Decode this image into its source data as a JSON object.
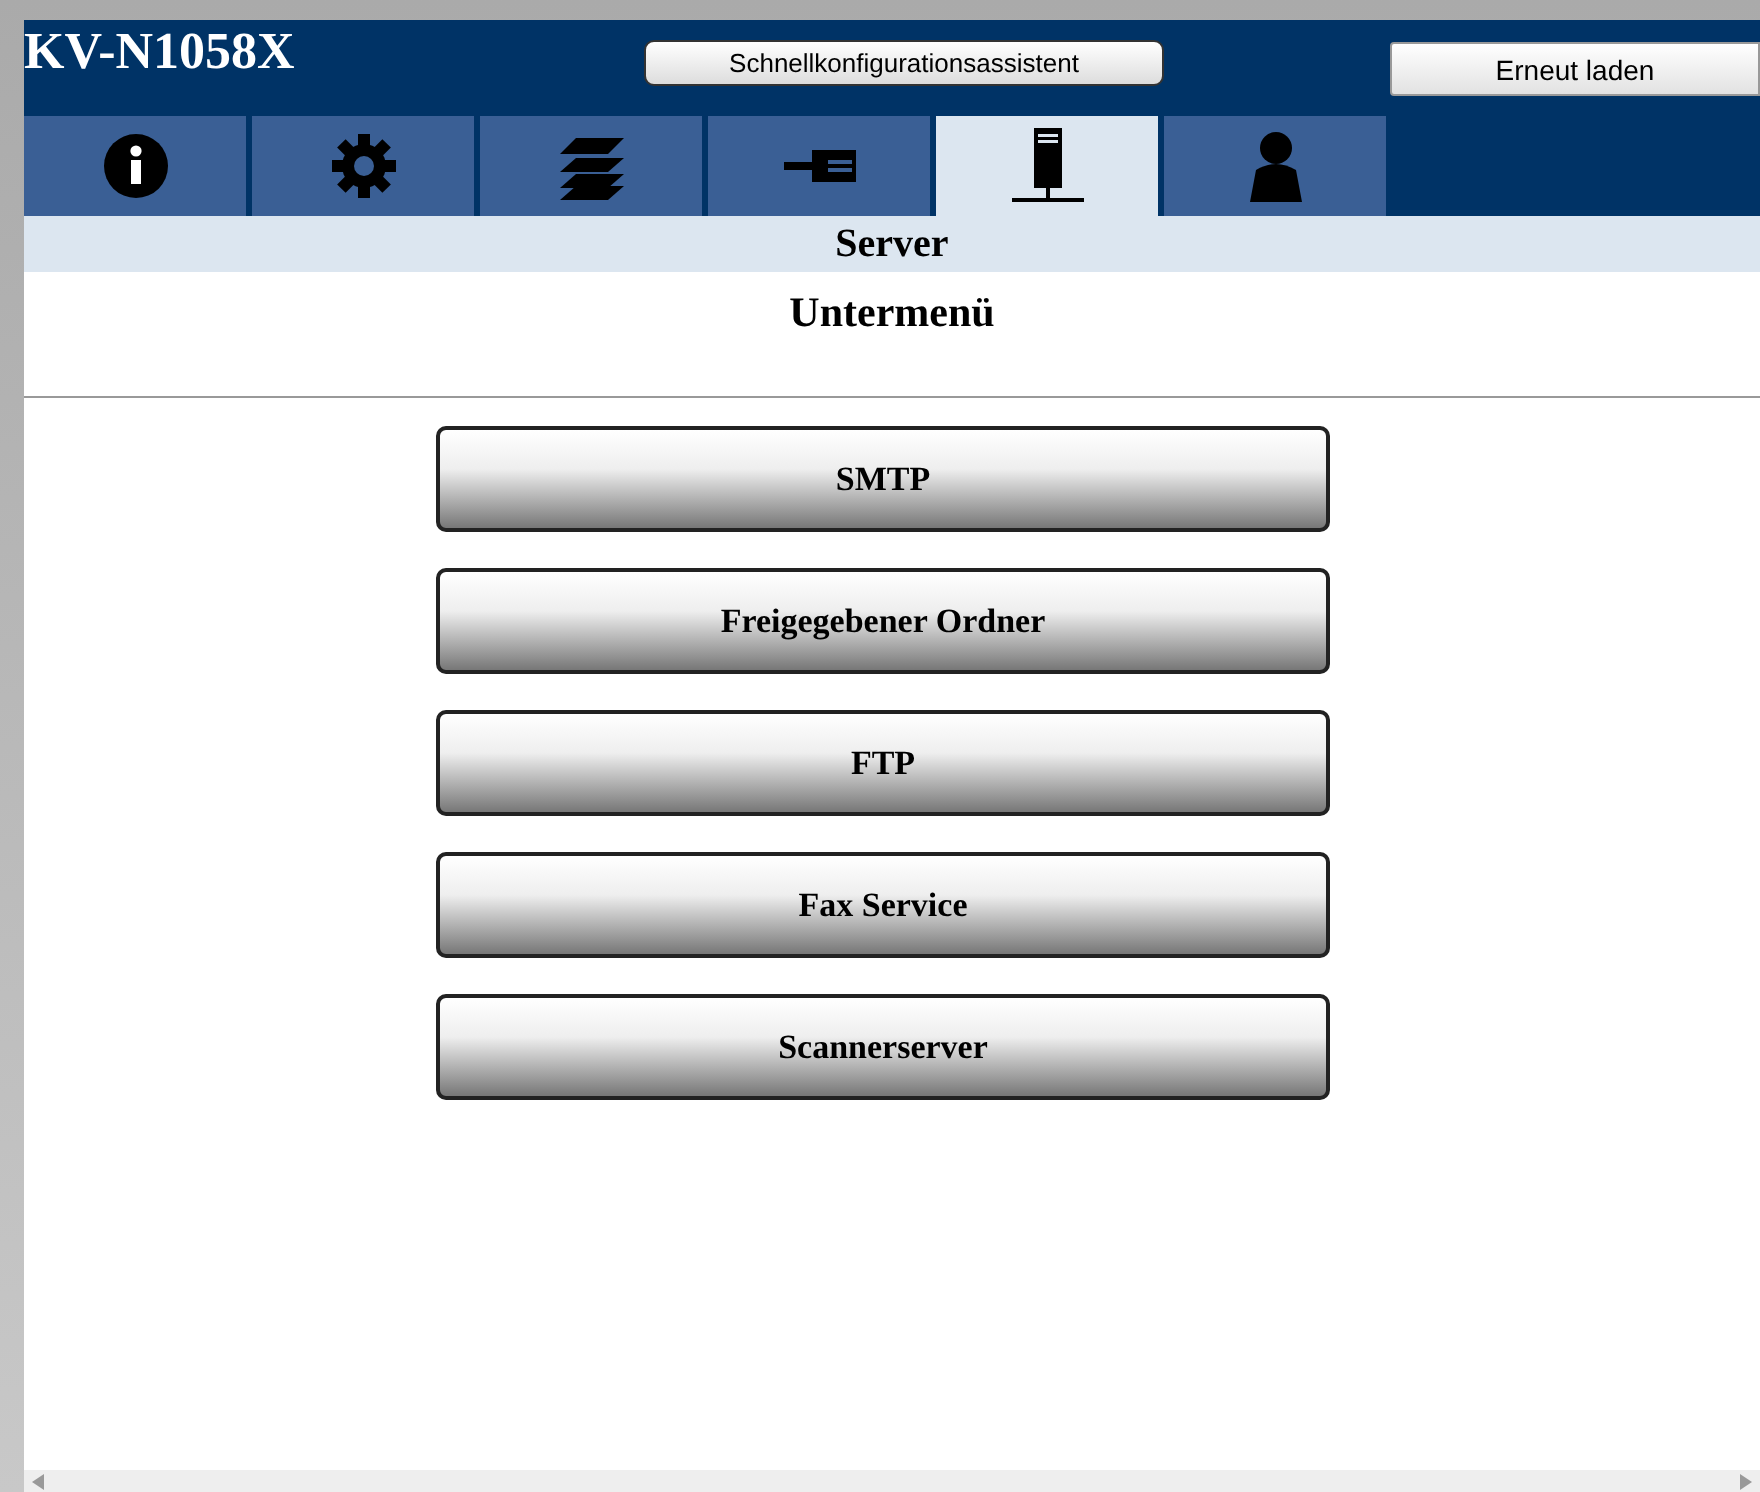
{
  "header": {
    "title": "KV-N1058X",
    "wizard_button": "Schnellkonfigurationsassistent",
    "reload_button": "Erneut laden"
  },
  "tabs": [
    {
      "kind": "info",
      "selected": false
    },
    {
      "kind": "gear",
      "selected": false
    },
    {
      "kind": "layers",
      "selected": false
    },
    {
      "kind": "plug",
      "selected": false
    },
    {
      "kind": "server",
      "selected": true
    },
    {
      "kind": "person",
      "selected": false
    }
  ],
  "section_title": "Server",
  "submenu_heading": "Untermenü",
  "menu_buttons": [
    "SMTP",
    "Freigegebener Ordner",
    "FTP",
    "Fax Service",
    "Scannerserver"
  ]
}
